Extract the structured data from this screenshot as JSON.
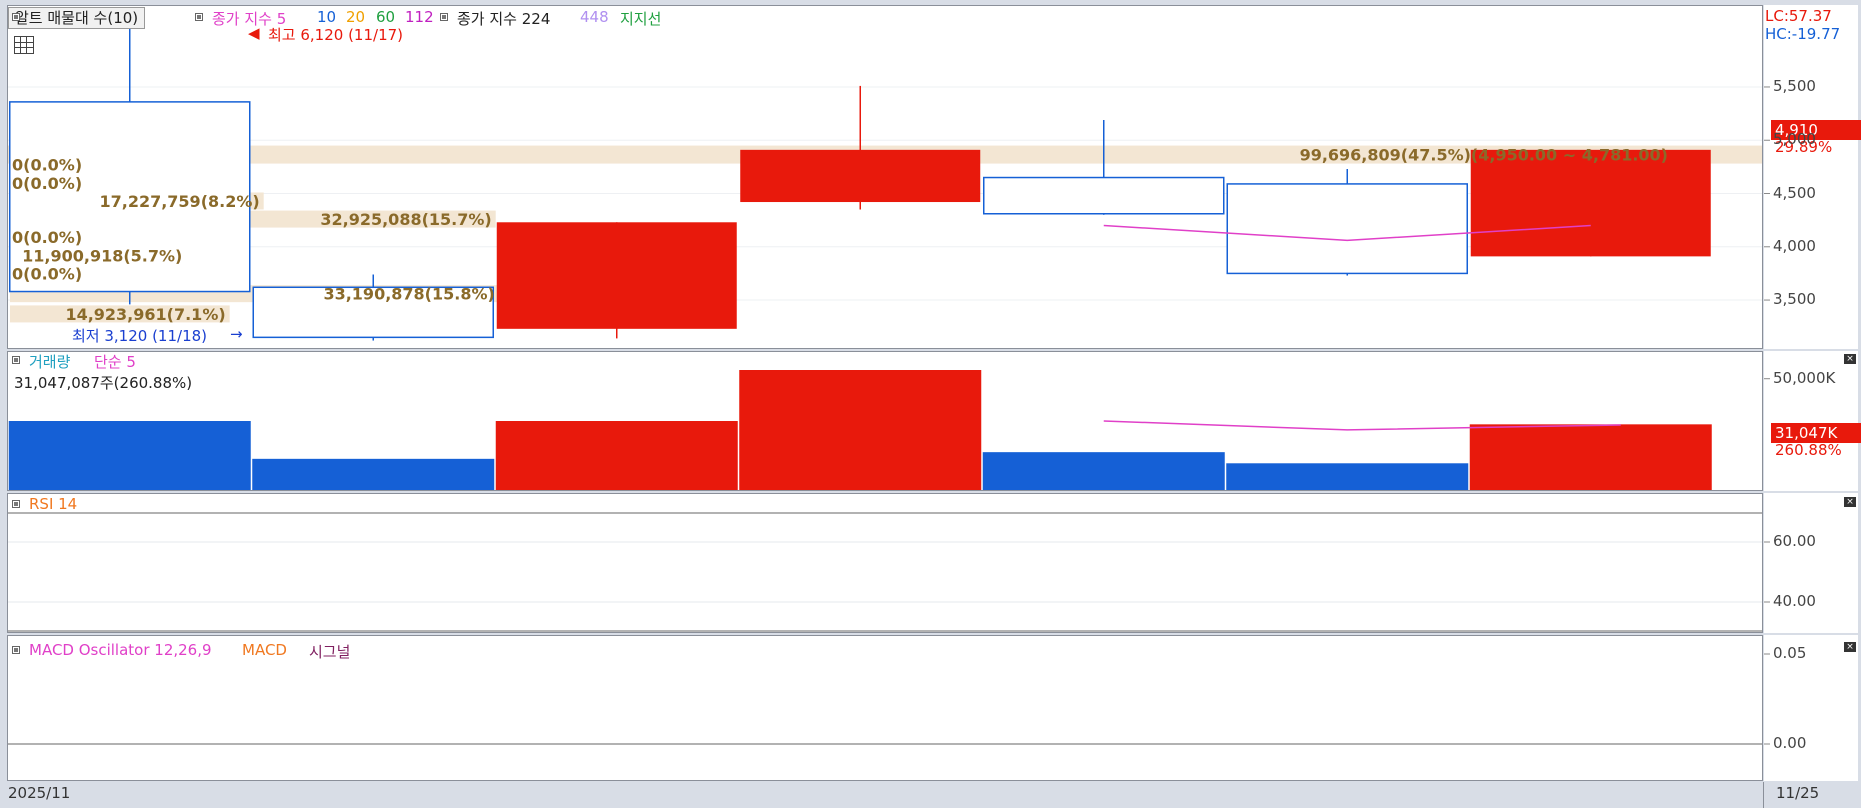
{
  "legend": {
    "alt_button": "알트 매물대 수(10)",
    "ma_label": "종가 지수 5",
    "ma_10": "10",
    "ma_20": "20",
    "ma_60": "60",
    "ma_112": "112",
    "ma2_label": "종가 지수 224",
    "ma2_448": "448",
    "support": "지지선",
    "high_label": "최고 6,120 (11/17)",
    "low_label": "최저 3,120 (11/18)",
    "lc": "LC:57.37",
    "hc": "HC:-19.77",
    "price_badge": "4,910",
    "price_pct": "29.89%",
    "vol_title": "거래량",
    "vol_ma": "단순 5",
    "vol_value": "31,047,087주(260.88%)",
    "vol_badge": "31,047K",
    "vol_pct": "260.88%",
    "rsi_title": "RSI 14",
    "macd_title": "MACD Oscillator 12,26,9",
    "macd_label": "MACD",
    "macd_signal": "시그널",
    "date_left": "2025/11",
    "date_right": "11/25",
    "colors": {
      "up": "#e8190c",
      "down": "#1560d6",
      "ma": "#e040c8",
      "profile": "#f3e6d3",
      "profile_text": "#8a6a2a"
    }
  },
  "chart_data": [
    {
      "type": "candlestick",
      "name": "price",
      "ylim": [
        3050,
        6260
      ],
      "yticks": [
        3500,
        4000,
        4500,
        5000,
        5500
      ],
      "ytick_labels": [
        "3,500",
        "4,000",
        "4,500",
        "5,000",
        "5,500"
      ],
      "candles": [
        {
          "open": 5360,
          "high": 6120,
          "low": 3460,
          "close": 3580,
          "dir": "down"
        },
        {
          "open": 3620,
          "high": 3740,
          "low": 3120,
          "close": 3150,
          "dir": "down"
        },
        {
          "open": 3230,
          "high": 4230,
          "low": 3140,
          "close": 4230,
          "dir": "up"
        },
        {
          "open": 4420,
          "high": 5510,
          "low": 4350,
          "close": 4910,
          "dir": "up"
        },
        {
          "open": 4650,
          "high": 5190,
          "low": 4300,
          "close": 4310,
          "dir": "down"
        },
        {
          "open": 4590,
          "high": 4730,
          "low": 3730,
          "close": 3750,
          "dir": "down"
        },
        {
          "open": 3910,
          "high": 4910,
          "low": 3910,
          "close": 4910,
          "dir": "up"
        }
      ],
      "ma5": [
        null,
        null,
        null,
        null,
        4200,
        4060,
        4200
      ],
      "volume_profile": [
        {
          "label": "0(0.0%)",
          "price": 4770,
          "share": 0
        },
        {
          "label": "0(0.0%)",
          "price": 4600,
          "share": 0
        },
        {
          "label": "17,227,759(8.2%)",
          "price": 4430,
          "share": 8.2
        },
        {
          "label": "32,925,088(15.7%)",
          "price": 4260,
          "share": 15.7
        },
        {
          "label": "0(0.0%)",
          "price": 4090,
          "share": 0
        },
        {
          "label": "11,900,918(5.7%)",
          "price": 3920,
          "share": 5.7
        },
        {
          "label": "0(0.0%)",
          "price": 3750,
          "share": 0
        },
        {
          "label": "33,190,878(15.8%)",
          "price": 3560,
          "share": 15.8
        },
        {
          "label": "14,923,961(7.1%)",
          "price": 3370,
          "share": 7.1
        }
      ],
      "top_profile": {
        "label": "99,696,809(47.5%)",
        "range": "(4,950.00 ~ 4,781.00)",
        "share": 47.5
      }
    },
    {
      "type": "bar",
      "name": "volume",
      "ylim": [
        0,
        62000
      ],
      "yticks": [
        50000
      ],
      "ytick_labels": [
        "50,000K"
      ],
      "values": [
        31000,
        14000,
        31000,
        64000,
        17000,
        12000,
        29500
      ],
      "dir": [
        "down",
        "down",
        "up",
        "up",
        "down",
        "down",
        "up"
      ],
      "ma5": [
        null,
        null,
        null,
        null,
        31000,
        27000,
        29000
      ]
    },
    {
      "type": "line",
      "name": "rsi",
      "ylim": [
        30,
        76
      ],
      "yticks": [
        40,
        60
      ],
      "ytick_labels": [
        "40.00",
        "60.00"
      ],
      "values": []
    },
    {
      "type": "line",
      "name": "macd",
      "ylim": [
        -0.02,
        0.06
      ],
      "yticks": [
        0,
        0.05
      ],
      "ytick_labels": [
        "0.00",
        "0.05"
      ],
      "values": []
    }
  ]
}
